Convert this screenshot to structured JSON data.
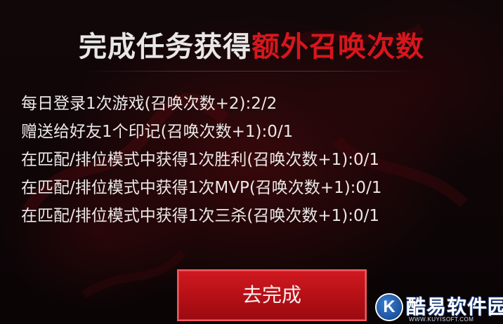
{
  "header": {
    "title_white": "完成任务获得",
    "title_red": "额外召唤次数"
  },
  "tasks": [
    "每日登录1次游戏(召唤次数+2):2/2",
    "赠送给好友1个印记(召唤次数+1):0/1",
    "在匹配/排位模式中获得1次胜利(召唤次数+1):0/1",
    "在匹配/排位模式中获得1次MVP(召唤次数+1):0/1",
    "在匹配/排位模式中获得1次三杀(召唤次数+1):0/1"
  ],
  "action": {
    "button_label": "去完成"
  },
  "watermark": {
    "badge": "K",
    "name": "酷易软件园",
    "url": "WWW.KUYISOFT.COM"
  },
  "colors": {
    "accent_red": "#d8161d",
    "button_red": "#c0141b",
    "text": "#ece8e8",
    "background": "#0b0506"
  }
}
